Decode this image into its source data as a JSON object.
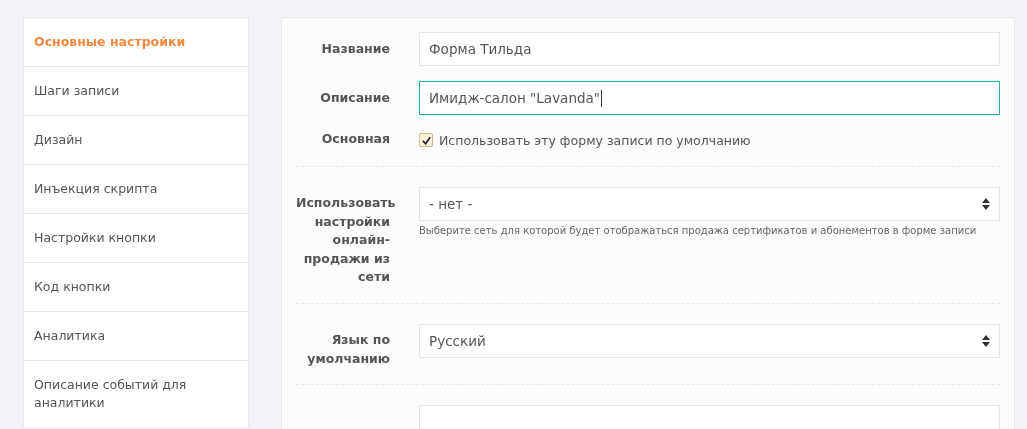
{
  "sidebar": {
    "items": [
      {
        "label": "Основные настройки",
        "selected": true
      },
      {
        "label": "Шаги записи",
        "selected": false
      },
      {
        "label": "Дизайн",
        "selected": false
      },
      {
        "label": "Инъекция скрипта",
        "selected": false
      },
      {
        "label": "Настройки кнопки",
        "selected": false
      },
      {
        "label": "Код кнопки",
        "selected": false
      },
      {
        "label": "Аналитика",
        "selected": false
      },
      {
        "label": "Описание событий для аналитики",
        "selected": false
      }
    ]
  },
  "form": {
    "rows": [
      {
        "kind": "text",
        "label": "Название",
        "value": "Форма Тильда",
        "focused": false
      },
      {
        "kind": "text",
        "label": "Описание",
        "value": "Имидж-салон \"Lavanda\"",
        "focused": true
      },
      {
        "kind": "checkbox",
        "label": "Основная",
        "text": "Использовать эту форму записи по умолчанию",
        "checked": true
      },
      {
        "kind": "select",
        "label": "Использовать настройки онлайн-продажи из сети",
        "value": "- нет -",
        "hint": "Выберите сеть для которой будет отображаться продажа сертификатов и абонементов в форме записи"
      },
      {
        "kind": "select",
        "label": "Язык по умолчанию",
        "value": "Русский"
      },
      {
        "kind": "partial"
      }
    ]
  }
}
